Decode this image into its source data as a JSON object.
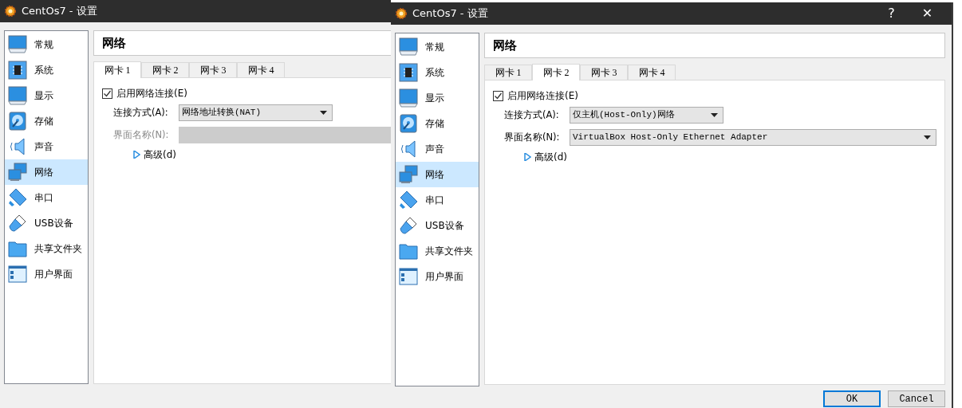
{
  "windows": [
    {
      "title": "CentOs7 - 设置",
      "sidebar": [
        {
          "label": "常规",
          "selected": false
        },
        {
          "label": "系统",
          "selected": false
        },
        {
          "label": "显示",
          "selected": false
        },
        {
          "label": "存储",
          "selected": false
        },
        {
          "label": "声音",
          "selected": false
        },
        {
          "label": "网络",
          "selected": true
        },
        {
          "label": "串口",
          "selected": false
        },
        {
          "label": "USB设备",
          "selected": false
        },
        {
          "label": "共享文件夹",
          "selected": false
        },
        {
          "label": "用户界面",
          "selected": false
        }
      ],
      "page_title": "网络",
      "tabs": [
        {
          "label": "网卡 1",
          "selected": true
        },
        {
          "label": "网卡 2",
          "selected": false
        },
        {
          "label": "网卡 3",
          "selected": false
        },
        {
          "label": "网卡 4",
          "selected": false
        }
      ],
      "enable": {
        "label": "启用网络连接(E)",
        "checked": true
      },
      "fields": [
        {
          "label": "连接方式(A):",
          "value": "网络地址转换(NAT)",
          "disabled": false
        },
        {
          "label": "界面名称(N):",
          "disabled": true
        }
      ],
      "advanced": {
        "label": "高级(d)",
        "expanded": false
      }
    },
    {
      "title": "CentOs7 - 设置",
      "title_buttons": [
        "?",
        "✕"
      ],
      "sidebar": [
        {
          "label": "常规",
          "selected": false
        },
        {
          "label": "系统",
          "selected": false
        },
        {
          "label": "显示",
          "selected": false
        },
        {
          "label": "存储",
          "selected": false
        },
        {
          "label": "声音",
          "selected": false
        },
        {
          "label": "网络",
          "selected": true
        },
        {
          "label": "串口",
          "selected": false
        },
        {
          "label": "USB设备",
          "selected": false
        },
        {
          "label": "共享文件夹",
          "selected": false
        },
        {
          "label": "用户界面",
          "selected": false
        }
      ],
      "page_title": "网络",
      "tabs": [
        {
          "label": "网卡 1",
          "selected": false
        },
        {
          "label": "网卡 2",
          "selected": true
        },
        {
          "label": "网卡 3",
          "selected": false
        },
        {
          "label": "网卡 4",
          "selected": false
        }
      ],
      "enable": {
        "label": "启用网络连接(E)",
        "checked": true
      },
      "fields": [
        {
          "label": "连接方式(A):",
          "value": "仅主机(Host-Only)网络",
          "disabled": false
        },
        {
          "label": "界面名称(N):",
          "value": "VirtualBox Host-Only Ethernet Adapter",
          "disabled": false
        }
      ],
      "advanced": {
        "label": "高级(d)",
        "expanded": false
      },
      "buttons": [
        {
          "label": "OK",
          "default": true
        },
        {
          "label": "Cancel",
          "default": false
        }
      ]
    }
  ]
}
